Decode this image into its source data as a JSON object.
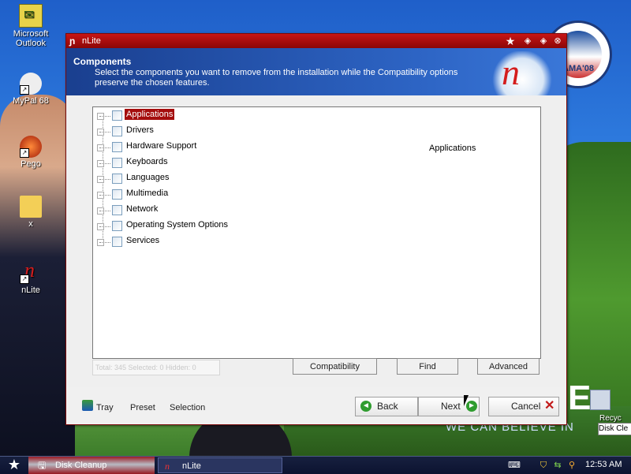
{
  "desktop": {
    "icons": [
      {
        "label": "Microsoft Outlook",
        "icon": "outlook-icon"
      },
      {
        "label": "MyPal 68",
        "icon": "mypal-icon"
      },
      {
        "label": "Pego",
        "icon": "pego-icon"
      },
      {
        "label": "x",
        "icon": "folder-icon"
      },
      {
        "label": "nLite",
        "icon": "nlite-icon"
      }
    ],
    "wallpaper_text": "WE CAN BELIEVE IN",
    "wallpaper_e": "E",
    "obama_text": "AMA'08",
    "recycle_label": "Recyc",
    "disk_clean_popup": "Disk Cle"
  },
  "window": {
    "title": "nLite",
    "header_title": "Components",
    "header_subtitle": "Select the components you want to remove from the installation while the Compatibility options preserve the chosen features.",
    "tree_items": [
      {
        "label": "Applications",
        "selected": true
      },
      {
        "label": "Drivers",
        "selected": false
      },
      {
        "label": "Hardware Support",
        "selected": false
      },
      {
        "label": "Keyboards",
        "selected": false
      },
      {
        "label": "Languages",
        "selected": false
      },
      {
        "label": "Multimedia",
        "selected": false
      },
      {
        "label": "Network",
        "selected": false
      },
      {
        "label": "Operating System Options",
        "selected": false
      },
      {
        "label": "Services",
        "selected": false
      }
    ],
    "description": "Applications",
    "status_text": "Total: 345 Selected: 0 Hidden: 0",
    "buttons": {
      "compatibility": "Compatibility",
      "find": "Find",
      "advanced": "Advanced",
      "tray": "Tray",
      "preset": "Preset",
      "selection": "Selection",
      "back": "Back",
      "next": "Next",
      "cancel": "Cancel"
    }
  },
  "taskbar": {
    "tasks": [
      {
        "label": "Disk Cleanup",
        "icon": "disk-cleanup-icon",
        "active": false
      },
      {
        "label": "nLite",
        "icon": "nlite-icon",
        "active": true
      }
    ],
    "clock": "12:53 AM"
  },
  "colors": {
    "title_red": "#a40d0d",
    "header_blue": "#2d64c4",
    "selection_red": "#a40d0d"
  }
}
